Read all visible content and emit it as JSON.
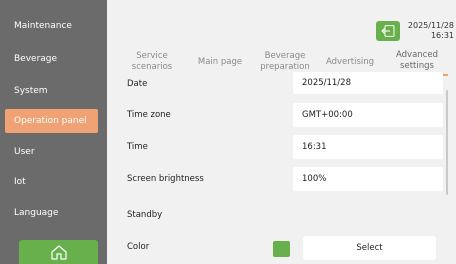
{
  "sidebar": {
    "items": [
      {
        "label": "Maintenance"
      },
      {
        "label": "Beverage"
      },
      {
        "label": "System"
      },
      {
        "label": "Operation panel"
      },
      {
        "label": "User"
      },
      {
        "label": "Iot"
      },
      {
        "label": "Language"
      }
    ],
    "active_color": "#f0a275"
  },
  "header": {
    "date": "2025/11/28",
    "time": "16:31",
    "tabs": [
      {
        "label": "Service scenarios"
      },
      {
        "label": "Main page"
      },
      {
        "label": "Beverage preparation"
      },
      {
        "label": "Advertising"
      },
      {
        "label": "Advanced settings"
      }
    ],
    "active_tab": "Advanced settings"
  },
  "settings": {
    "date": {
      "label": "Date",
      "value": "2025/11/28"
    },
    "timezone": {
      "label": "Time zone",
      "value": "GMT+00:00"
    },
    "time": {
      "label": "Time",
      "value": "16:31"
    },
    "brightness": {
      "label": "Screen brightness",
      "value": "100%"
    },
    "standby": {
      "label": "Standby"
    },
    "color": {
      "label": "Color",
      "swatch": "#68b04b",
      "select_label": "Select"
    }
  },
  "icons": {
    "exit": "exit-icon",
    "home": "home-icon"
  },
  "colors": {
    "accent": "#f0a275",
    "green": "#68b04b",
    "sidebar": "#6b6b6b"
  }
}
